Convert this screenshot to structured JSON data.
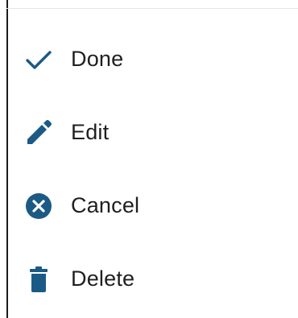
{
  "menu": {
    "items": [
      {
        "label": "Done",
        "icon": "check-icon"
      },
      {
        "label": "Edit",
        "icon": "pencil-icon"
      },
      {
        "label": "Cancel",
        "icon": "cancel-circle-icon"
      },
      {
        "label": "Delete",
        "icon": "trash-icon"
      }
    ]
  },
  "colors": {
    "icon": "#1c5a86",
    "text": "#1f1f1f",
    "background": "#ffffff"
  }
}
